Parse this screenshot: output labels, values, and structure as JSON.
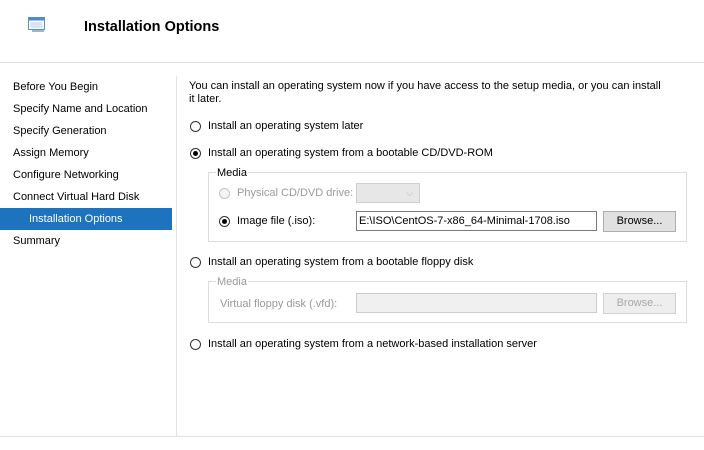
{
  "header": {
    "title": "Installation Options",
    "icon": "wizard-window-icon"
  },
  "nav": {
    "items": [
      {
        "label": "Before You Begin"
      },
      {
        "label": "Specify Name and Location"
      },
      {
        "label": "Specify Generation"
      },
      {
        "label": "Assign Memory"
      },
      {
        "label": "Configure Networking"
      },
      {
        "label": "Connect Virtual Hard Disk"
      },
      {
        "label": "Installation Options",
        "active": true
      },
      {
        "label": "Summary"
      }
    ]
  },
  "main": {
    "intro": "You can install an operating system now if you have access to the setup media, or you can install it later.",
    "option_later": "Install an operating system later",
    "option_cd": "Install an operating system from a bootable CD/DVD-ROM",
    "cd_media": {
      "legend": "Media",
      "physical_label": "Physical CD/DVD drive:",
      "physical_value": "",
      "image_label": "Image file (.iso):",
      "image_value": "E:\\ISO\\CentOS-7-x86_64-Minimal-1708.iso",
      "browse_label": "Browse..."
    },
    "option_floppy": "Install an operating system from a bootable floppy disk",
    "floppy_media": {
      "legend": "Media",
      "vfd_label": "Virtual floppy disk (.vfd):",
      "vfd_value": "",
      "browse_label": "Browse..."
    },
    "option_network": "Install an operating system from a network-based installation server",
    "selected_option": "cd",
    "selected_media": "image"
  },
  "colors": {
    "accent": "#1e73be"
  }
}
